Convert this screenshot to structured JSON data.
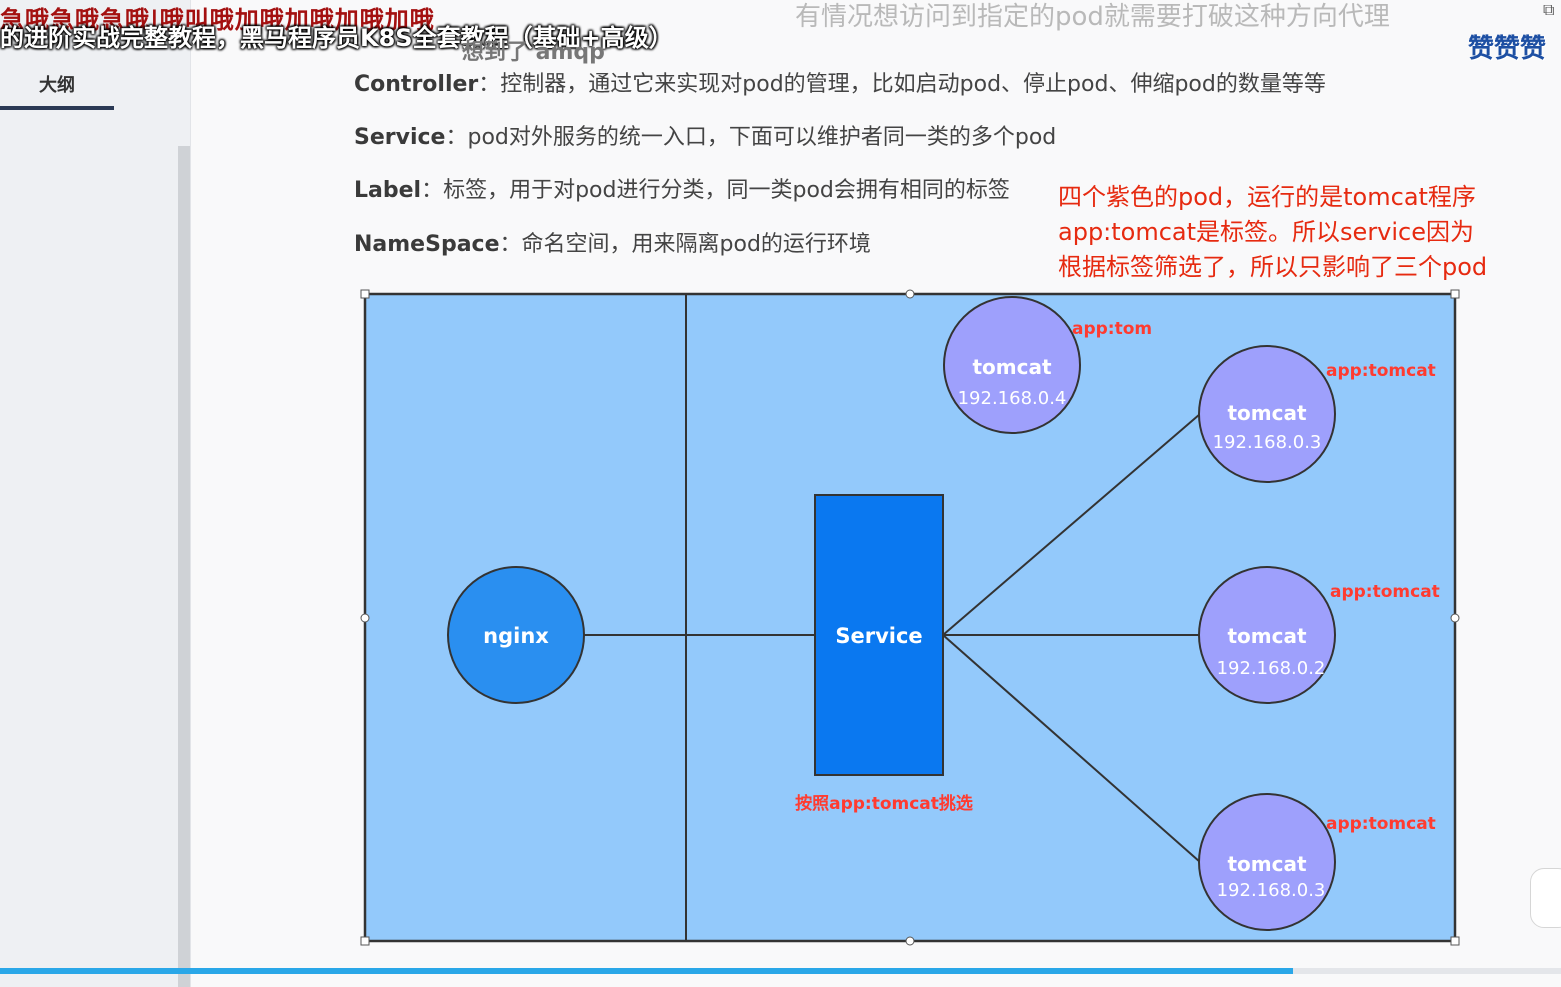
{
  "overlay": {
    "danmaku_red": "急哦急哦急哦|哦叫哦加哦加哦加哦加哦",
    "video_title": "的进阶实战完整教程，黑马程序员K8S全套教程（基础+高级）",
    "danmaku_gray": "想到了  amqp",
    "danmaku_top_right": "有情况想访问到指定的pod就需要打破这种方向代理",
    "danmaku_zan": "赞赞赞"
  },
  "sidebar": {
    "tab_label": "大纲"
  },
  "terms": [
    {
      "name": "Controller",
      "sep": "：",
      "desc": "控制器，通过它来实现对pod的管理，比如启动pod、停止pod、伸缩pod的数量等等"
    },
    {
      "name": "Service",
      "sep": "：",
      "desc": "pod对外服务的统一入口，下面可以维护者同一类的多个pod"
    },
    {
      "name": "Label",
      "sep": "：",
      "desc": "标签，用于对pod进行分类，同一类pod会拥有相同的标签"
    },
    {
      "name": "NameSpace",
      "sep": "：",
      "desc": "命名空间，用来隔离pod的运行环境"
    }
  ],
  "note": {
    "line1": "四个紫色的pod，运行的是tomcat程序",
    "line2": "app:tomcat是标签。所以service因为",
    "line3": "根据标签筛选了，所以只影响了三个pod"
  },
  "diagram": {
    "colors": {
      "bg": "#93c9fb",
      "nginx": "#2a8ff0",
      "service": "#0a78f0",
      "pod": "#9ea0fc",
      "label": "#ff3b30",
      "line": "#333333"
    },
    "nginx": {
      "name": "nginx"
    },
    "service": {
      "name": "Service",
      "selector_caption": "按照app:tomcat挑选"
    },
    "pods": [
      {
        "name": "tomcat",
        "ip": "192.168.0.4",
        "label": "app:tom"
      },
      {
        "name": "tomcat",
        "ip": "192.168.0.3",
        "label": "app:tomcat"
      },
      {
        "name": "tomcat",
        "ip": "192.168.0.2",
        "label": "app:tomcat"
      },
      {
        "name": "tomcat",
        "ip": "192.168.0.3",
        "label": "app:tomcat"
      }
    ]
  },
  "progress": {
    "fraction": 0.828
  }
}
